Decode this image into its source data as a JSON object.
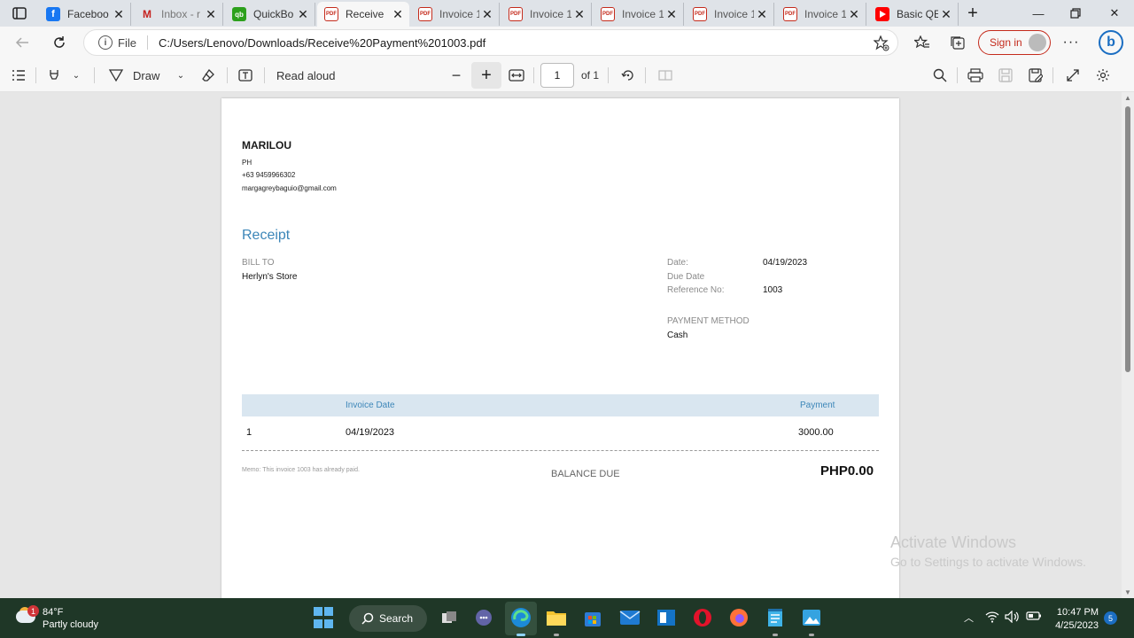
{
  "tabs": [
    {
      "label": "Faceboo",
      "icon": "facebook-icon"
    },
    {
      "label": "Inbox - r",
      "icon": "gmail-icon"
    },
    {
      "label": "QuickBo",
      "icon": "quickbooks-icon"
    },
    {
      "label": "Receive",
      "icon": "pdf-icon",
      "active": true
    },
    {
      "label": "Invoice 1",
      "icon": "pdf-icon"
    },
    {
      "label": "Invoice 1",
      "icon": "pdf-icon"
    },
    {
      "label": "Invoice 1",
      "icon": "pdf-icon"
    },
    {
      "label": "Invoice 1",
      "icon": "pdf-icon"
    },
    {
      "label": "Invoice 1",
      "icon": "pdf-icon"
    },
    {
      "label": "Basic QE",
      "icon": "youtube-icon"
    }
  ],
  "address": {
    "scheme_label": "File",
    "url": "C:/Users/Lenovo/Downloads/Receive%20Payment%201003.pdf"
  },
  "browser": {
    "signin_label": "Sign in"
  },
  "pdf_toolbar": {
    "draw_label": "Draw",
    "read_aloud_label": "Read aloud",
    "page_current": "1",
    "page_total": "of 1"
  },
  "document": {
    "company": "MARILOU",
    "country": "PH",
    "phone": "+63 9459966302",
    "email": "margagreybaguio@gmail.com",
    "heading": "Receipt",
    "bill_to_label": "BILL TO",
    "bill_to_value": "Herlyn's Store",
    "date_label": "Date:",
    "date_value": "04/19/2023",
    "due_date_label": "Due Date",
    "reference_label": "Reference No:",
    "reference_value": "1003",
    "payment_method_label": "PAYMENT METHOD",
    "payment_method_value": "Cash",
    "table": {
      "col_invoice_date": "Invoice Date",
      "col_payment": "Payment",
      "rows": [
        {
          "num": "1",
          "invoice_date": "04/19/2023",
          "payment": "3000.00"
        }
      ]
    },
    "memo": "Memo: This invoice 1003 has already paid.",
    "balance_label": "BALANCE DUE",
    "balance_value": "PHP0.00"
  },
  "watermark": {
    "line1": "Activate Windows",
    "line2": "Go to Settings to activate Windows."
  },
  "taskbar": {
    "weather_temp": "84°F",
    "weather_cond": "Partly cloudy",
    "weather_badge": "1",
    "search_label": "Search",
    "time": "10:47 PM",
    "date": "4/25/2023",
    "notification_count": "5"
  }
}
